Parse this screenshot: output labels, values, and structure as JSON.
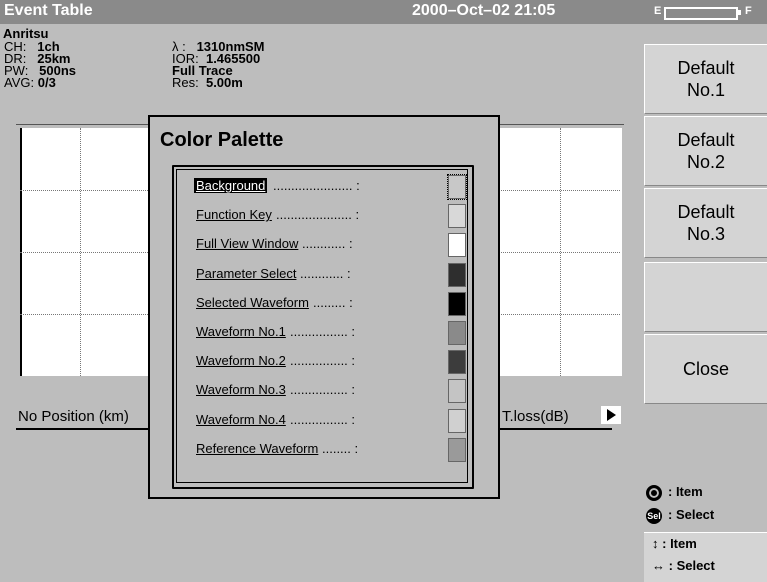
{
  "window": {
    "title": "Event Table",
    "datetime": "2000–Oct–02 21:05",
    "battery_empty_label": "E",
    "battery_full_label": "F"
  },
  "brand": "Anritsu",
  "params": {
    "ch_label": "CH:",
    "ch_value": "1ch",
    "dr_label": "DR:",
    "dr_value": "25km",
    "pw_label": "PW:",
    "pw_value": "500ns",
    "avg_label": "AVG:",
    "avg_value": "0/3",
    "lambda_label": "λ :",
    "lambda_value": "1310nmSM",
    "ior_label": "IOR:",
    "ior_value": "1.465500",
    "trace_value": "Full Trace",
    "res_label": "Res:",
    "res_value": "5.00m"
  },
  "table": {
    "col_no_position": "No  Position (km)",
    "col_tloss": "T.loss(dB)"
  },
  "dialog": {
    "title": "Color Palette",
    "items": [
      {
        "label": "Background",
        "dots": "...................... :",
        "color": "#c8c8c8",
        "selected": true
      },
      {
        "label": "Function Key",
        "dots": "..................... :",
        "color": "#d8d8d8"
      },
      {
        "label": "Full View Window",
        "dots": "............ :",
        "color": "#ffffff"
      },
      {
        "label": "Parameter Select",
        "dots": "............ :",
        "color": "#2e2e2e"
      },
      {
        "label": "Selected Waveform",
        "dots": "......... :",
        "color": "#000000"
      },
      {
        "label": "Waveform No.1",
        "dots": "................ :",
        "color": "#8a8a8a"
      },
      {
        "label": "Waveform No.2",
        "dots": "................ :",
        "color": "#3c3c3c"
      },
      {
        "label": "Waveform No.3",
        "dots": "................ :",
        "color": "#c4c4c4"
      },
      {
        "label": "Waveform No.4",
        "dots": "................ :",
        "color": "#d0d0d0"
      },
      {
        "label": "Reference Waveform",
        "dots": "........ :",
        "color": "#9a9a9a"
      }
    ]
  },
  "softkeys": [
    {
      "label": "Default\nNo.1"
    },
    {
      "label": "Default\nNo.2"
    },
    {
      "label": "Default\nNo.3"
    },
    {
      "label": ""
    },
    {
      "label": "Close"
    }
  ],
  "legend": {
    "item_text": ": Item",
    "select_text": ": Select",
    "sel_icon_text": "Sel"
  },
  "hints": {
    "updown_text": ": Item",
    "leftright_text": ": Select"
  }
}
